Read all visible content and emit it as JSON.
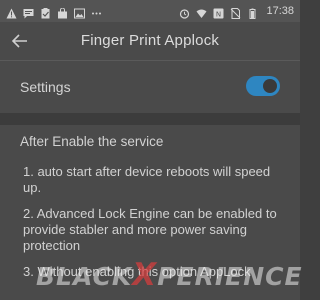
{
  "status_bar": {
    "time": "17:38",
    "left_icons": [
      "warning-icon",
      "message-icon",
      "clipboard-icon",
      "shopping-bag-icon",
      "image-icon",
      "more-dots-icon"
    ],
    "right_icons": [
      "alarm-icon",
      "wifi-icon",
      "sync-icon",
      "no-sim-icon",
      "battery-icon"
    ]
  },
  "toolbar": {
    "title": "Finger Print Applock",
    "back_icon": "arrow-left-icon"
  },
  "settings": {
    "label": "Settings",
    "enabled": true,
    "accent_color": "#2e86c1"
  },
  "content": {
    "heading": "After Enable the service",
    "items": [
      "1. auto start after device reboots will speed up.",
      "2. Advanced Lock Engine can be enabled to provide stabler and more power saving protection",
      "3. Without enabling this option AppLock"
    ]
  },
  "watermark": {
    "text_before": "BLACK",
    "text_x": "X",
    "text_after": "PERIENCE"
  }
}
